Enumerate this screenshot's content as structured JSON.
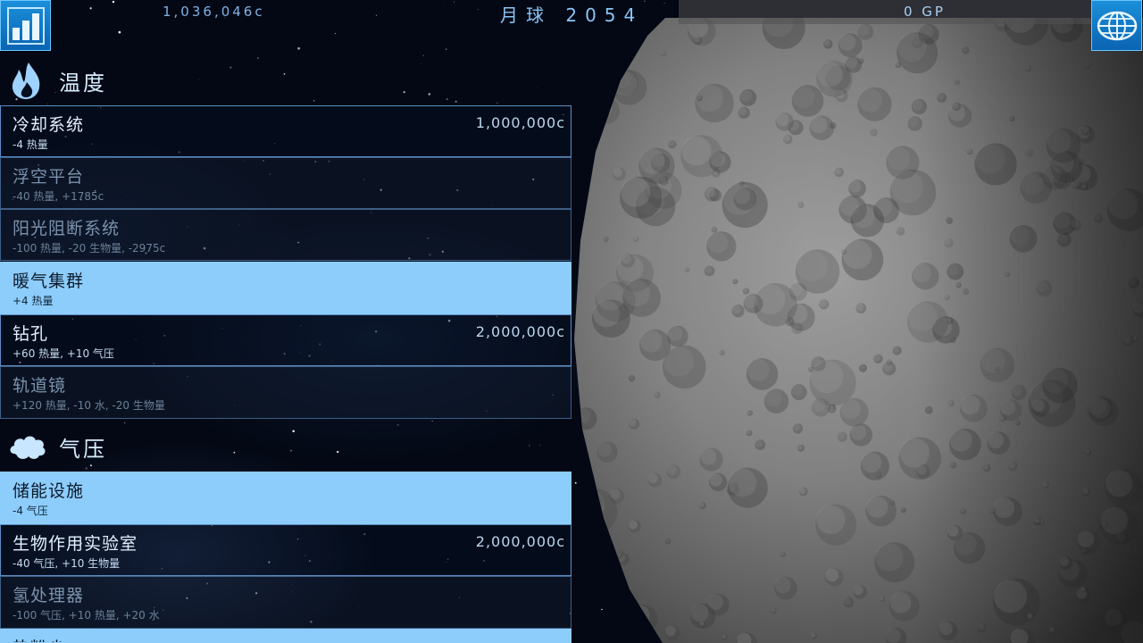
{
  "hud": {
    "money": "1,036,046c",
    "planet_title": "月球  2054",
    "gp": "0 GP",
    "stats_icon": "bar-chart-icon",
    "globe_icon": "globe-icon"
  },
  "sections": {
    "temperature": {
      "label": "温度",
      "icon": "flame-icon",
      "items": [
        {
          "name": "冷却系统",
          "desc": "-4 热量",
          "price": "1,000,000c",
          "state": "available"
        },
        {
          "name": "浮空平台",
          "desc": "-40 热量, +1785c",
          "price": "",
          "state": "locked"
        },
        {
          "name": "阳光阻断系统",
          "desc": "-100 热量, -20 生物量, -2975c",
          "price": "",
          "state": "locked"
        },
        {
          "name": "暖气集群",
          "desc": "+4 热量",
          "price": "",
          "state": "built"
        },
        {
          "name": "钻孔",
          "desc": "+60 热量, +10 气压",
          "price": "2,000,000c",
          "state": "available"
        },
        {
          "name": "轨道镜",
          "desc": "+120 热量, -10 水, -20 生物量",
          "price": "",
          "state": "locked"
        }
      ]
    },
    "pressure": {
      "label": "气压",
      "icon": "cloud-icon",
      "items": [
        {
          "name": "储能设施",
          "desc": "-4 气压",
          "price": "",
          "state": "built"
        },
        {
          "name": "生物作用实验室",
          "desc": "-40 气压, +10 生物量",
          "price": "2,000,000c",
          "state": "available"
        },
        {
          "name": "氢处理器",
          "desc": "-100 气压, +10 热量, +20 水",
          "price": "",
          "state": "locked"
        },
        {
          "name": "热粉尘",
          "desc": "",
          "price": "",
          "state": "built"
        }
      ]
    }
  },
  "colors": {
    "accent_blue": "#1b8fd8",
    "built_item": "#8dcdfc",
    "item_border": "#5c8ec4"
  }
}
